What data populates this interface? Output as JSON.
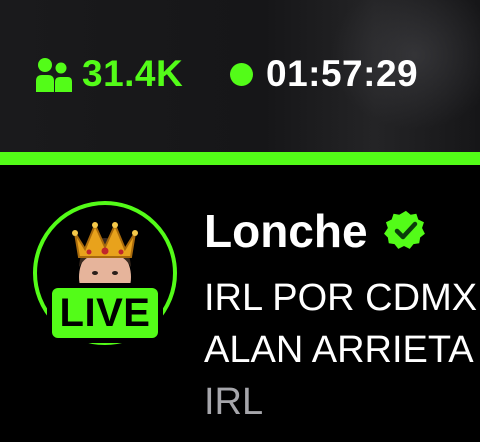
{
  "stats": {
    "viewers": "31.4K",
    "uptime": "01:57:29"
  },
  "channel": {
    "name": "Lonche",
    "verified": true,
    "live_badge": "LIVE",
    "title_lines": [
      "IRL POR CDMX",
      "ALAN ARRIETA"
    ],
    "category": "IRL"
  },
  "colors": {
    "accent": "#53fc18",
    "background": "#000000",
    "stats_background": "#1a1a1c",
    "text_primary": "#ffffff",
    "text_secondary": "#a6a6ab"
  },
  "icons": {
    "viewers": "viewers-icon",
    "live_indicator": "live-dot-icon",
    "verified": "verified-badge-icon",
    "crown": "crown-icon"
  }
}
